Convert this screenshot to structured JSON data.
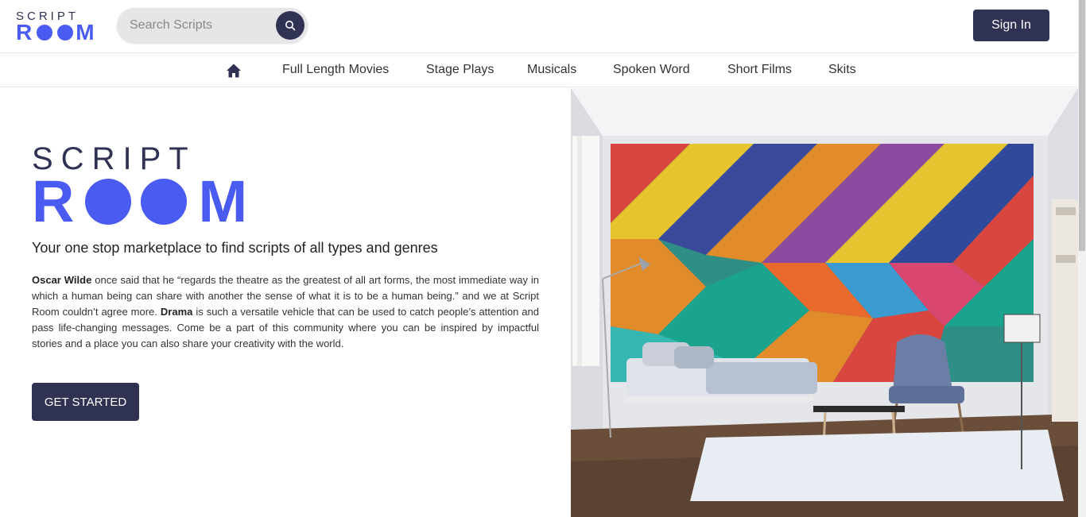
{
  "header": {
    "logo_top": "SCRIPT",
    "logo_bottom_r": "R",
    "logo_bottom_m": "M",
    "search_placeholder": "Search Scripts",
    "search_icon": "search-icon",
    "signin_label": "Sign In"
  },
  "nav": {
    "home_icon": "home-icon",
    "items": [
      "Full Length Movies",
      "Stage Plays",
      "Musicals",
      "Spoken Word",
      "Short Films",
      "Skits"
    ]
  },
  "hero": {
    "logo_top": "SCRIPT",
    "logo_bottom_r": "R",
    "logo_bottom_m": "M",
    "tagline": "Your one stop marketplace to find scripts of all types and genres",
    "quote_author": "Oscar Wilde",
    "para_part1": " once said that he “regards the theatre as the greatest of all art forms, the most immediate way in which a human being can share with another the sense of what it is to be a human being.” and we at Script Room couldn’t agree more. ",
    "para_bold": "Drama",
    "para_part2": " is such a versatile vehicle that can be used to catch people’s attention and pass life-changing messages. Come be a part of this community where you can be inspired by impactful stories and a place you can also share your creativity with the world.",
    "cta_label": "GET STARTED"
  },
  "colors": {
    "brand_dark": "#2f3253",
    "brand_blue": "#4a5bf2"
  }
}
